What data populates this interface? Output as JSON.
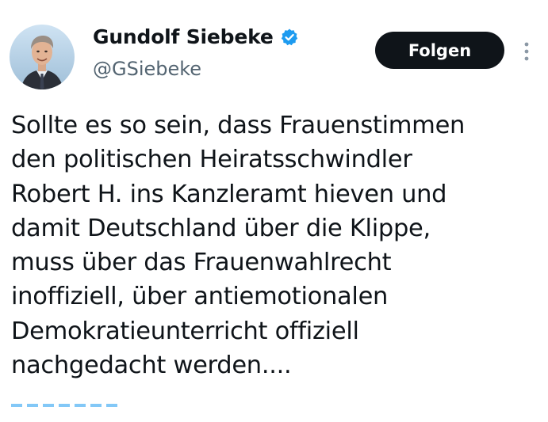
{
  "author": {
    "display_name": "Gundolf Siebeke",
    "handle": "@GSiebeke",
    "verified": true,
    "avatar_icon": "avatar-photo",
    "verified_icon": "verified-badge-icon",
    "verified_color": "#1d9bf0"
  },
  "actions": {
    "follow_label": "Folgen",
    "more_icon": "more-vertical-icon"
  },
  "tweet": {
    "lines": [
      "Sollte es so sein, dass Frauenstimmen",
      "den politischen Heiratsschwindler",
      "Robert H. ins Kanzleramt hieven und",
      "damit Deutschland über die Klippe,",
      "muss über das Frauenwahlrecht",
      "inoffiziell, über antiemotionalen",
      "Demokratieunterricht offiziell",
      "nachgedacht werden...."
    ]
  },
  "colors": {
    "text": "#0f1419",
    "secondary_text": "#536471",
    "button_bg": "#0f1419",
    "button_text": "#ffffff",
    "background": "#ffffff"
  }
}
